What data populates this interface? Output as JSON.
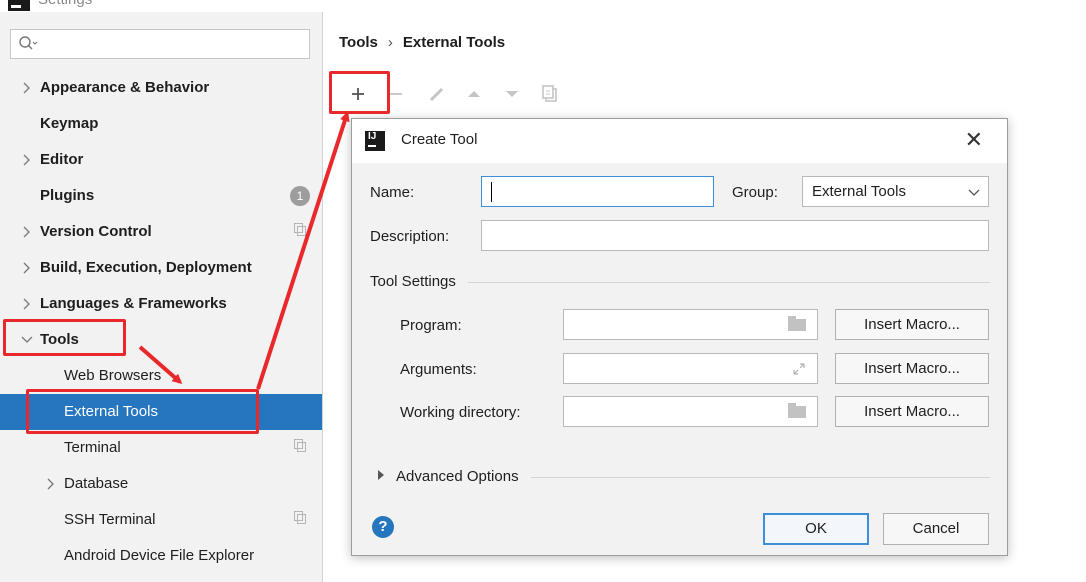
{
  "window": {
    "title": "Settings"
  },
  "sidebar": {
    "search_placeholder": "",
    "items": [
      {
        "label": "Appearance & Behavior",
        "chevron": ">",
        "badge": "",
        "copy": false
      },
      {
        "label": "Keymap",
        "chevron": "",
        "badge": "",
        "copy": false
      },
      {
        "label": "Editor",
        "chevron": ">",
        "badge": "",
        "copy": false
      },
      {
        "label": "Plugins",
        "chevron": "",
        "badge": "1",
        "copy": false
      },
      {
        "label": "Version Control",
        "chevron": ">",
        "badge": "",
        "copy": true
      },
      {
        "label": "Build, Execution, Deployment",
        "chevron": ">",
        "badge": "",
        "copy": false
      },
      {
        "label": "Languages & Frameworks",
        "chevron": ">",
        "badge": "",
        "copy": false
      },
      {
        "label": "Tools",
        "chevron": "v",
        "badge": "",
        "copy": false
      },
      {
        "label": "Web Browsers",
        "chevron": "",
        "badge": "",
        "copy": false
      },
      {
        "label": "External Tools",
        "chevron": "",
        "badge": "",
        "copy": false,
        "selected": true
      },
      {
        "label": "Terminal",
        "chevron": "",
        "badge": "",
        "copy": true
      },
      {
        "label": "Database",
        "chevron": ">",
        "badge": "",
        "copy": false
      },
      {
        "label": "SSH Terminal",
        "chevron": "",
        "badge": "",
        "copy": true
      },
      {
        "label": "Android Device File Explorer",
        "chevron": "",
        "badge": "",
        "copy": false
      }
    ]
  },
  "breadcrumb": {
    "parent": "Tools",
    "separator": "›",
    "current": "External Tools"
  },
  "toolbar": {
    "icons": [
      "plus-icon",
      "minus-icon",
      "edit-icon",
      "move-up-icon",
      "move-down-icon",
      "copy-icon"
    ]
  },
  "dialog": {
    "title": "Create Tool",
    "close_glyph": "✕",
    "name_label": "Name:",
    "name_value": "",
    "group_label": "Group:",
    "group_value": "External Tools",
    "description_label": "Description:",
    "description_value": "",
    "tool_settings_label": "Tool Settings",
    "program_label": "Program:",
    "program_value": "",
    "arguments_label": "Arguments:",
    "arguments_value": "",
    "working_dir_label": "Working directory:",
    "working_dir_value": "",
    "insert_macro_label": "Insert Macro...",
    "advanced_options_label": "Advanced Options",
    "ok_label": "OK",
    "cancel_label": "Cancel",
    "help_glyph": "?"
  },
  "colors": {
    "selection_blue": "#2675bf",
    "annotation_red": "#e8282b",
    "focus_blue": "#3d8fd8"
  }
}
